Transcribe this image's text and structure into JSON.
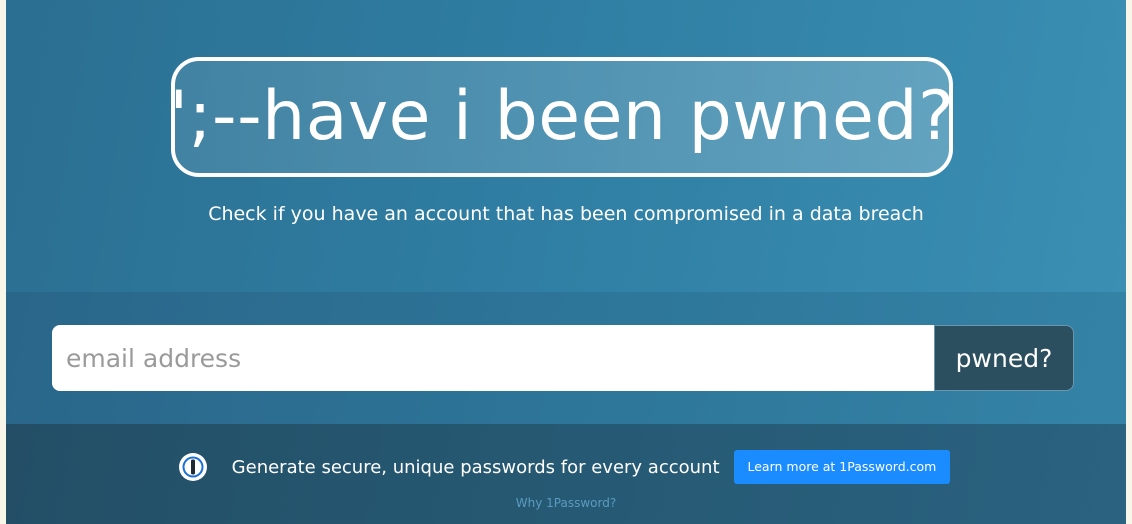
{
  "hero": {
    "logo_text": "';--have i been pwned?",
    "tagline": "Check if you have an account that has been compromised in a data breach"
  },
  "search": {
    "placeholder": "email address",
    "value": "",
    "button_label": "pwned?"
  },
  "promo": {
    "icon": "1password-logo-icon",
    "text": "Generate secure, unique passwords for every account",
    "cta_label": "Learn more at 1Password.com",
    "why_link": "Why 1Password?"
  },
  "colors": {
    "hero_bg": "#2f7da2",
    "search_bg": "#2d7599",
    "promo_bg": "#265973",
    "button_dark": "#2c4f60",
    "cta_blue": "#1a8cff"
  }
}
